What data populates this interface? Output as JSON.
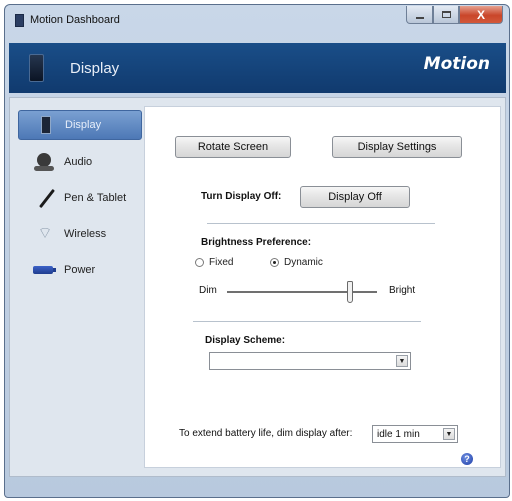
{
  "window": {
    "title": "Motion Dashboard",
    "controls": {
      "minimize": "",
      "maximize": "",
      "close": "X"
    }
  },
  "header": {
    "title": "Display",
    "brand": "Motion"
  },
  "sidebar": {
    "items": [
      {
        "label": "Display",
        "icon": "display-icon",
        "active": true
      },
      {
        "label": "Audio",
        "icon": "audio-icon"
      },
      {
        "label": "Pen & Tablet",
        "icon": "pen-icon"
      },
      {
        "label": "Wireless",
        "icon": "wireless-icon"
      },
      {
        "label": "Power",
        "icon": "battery-icon"
      }
    ]
  },
  "display_panel": {
    "rotate_button": "Rotate Screen",
    "settings_button": "Display Settings",
    "turn_off_label": "Turn Display Off:",
    "turn_off_button": "Display Off",
    "brightness_label": "Brightness Preference:",
    "radio_fixed": "Fixed",
    "radio_dynamic": "Dynamic",
    "selected_brightness_mode": "Dynamic",
    "slider_min_label": "Dim",
    "slider_max_label": "Bright",
    "brightness_level": 0.82,
    "scheme_label": "Display Scheme:",
    "scheme_value": "",
    "battery_label": "To extend battery life, dim display after:",
    "battery_value": "idle 1 min",
    "help": "?"
  }
}
